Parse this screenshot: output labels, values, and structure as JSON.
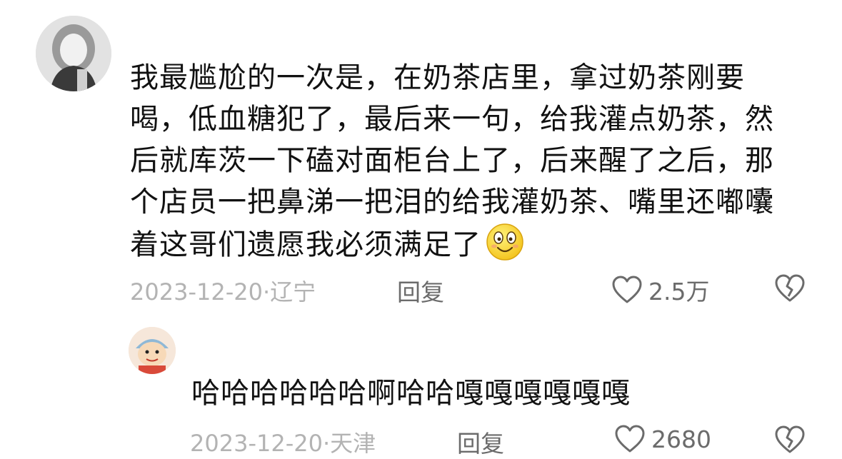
{
  "comment": {
    "text": "我最尴尬的一次是，在奶茶店里，拿过奶茶刚要喝，低血糖犯了，最后来一句，给我灌点奶茶，然后就库茨一下磕对面柜台上了，后来醒了之后，那个店员一把鼻涕一把泪的给我灌奶茶、嘴里还嘟囔着这哥们遗愿我必须满足了",
    "date": "2023-12-20",
    "location": "辽宁",
    "reply_label": "回复",
    "likes": "2.5万"
  },
  "reply": {
    "text": "哈哈哈哈哈哈啊哈哈嘎嘎嘎嘎嘎嘎",
    "date": "2023-12-20",
    "location": "天津",
    "reply_label": "回复",
    "likes": "2680"
  },
  "icons": {
    "like": "heart-outline-icon",
    "dislike": "broken-heart-icon",
    "emoji": "smiling-face-emoji-icon"
  },
  "colors": {
    "text": "#111111",
    "meta": "#b3b3b3",
    "action": "#6b6b6b"
  }
}
